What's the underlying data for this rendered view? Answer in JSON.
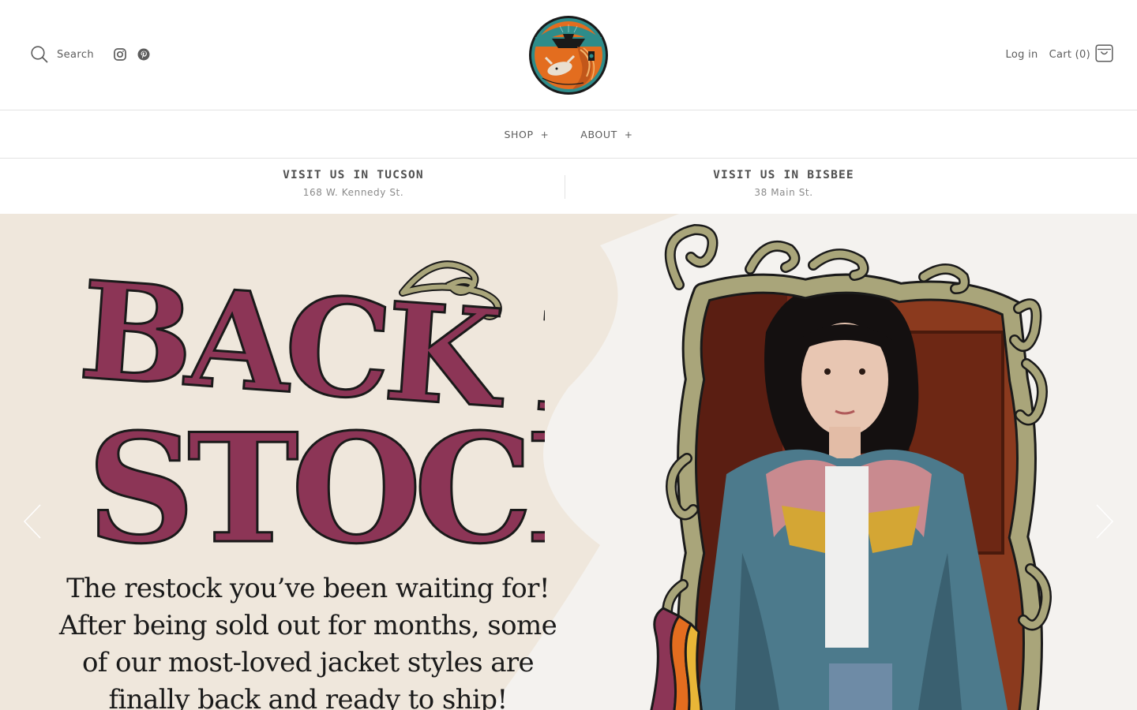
{
  "header": {
    "search_label": "Search",
    "login_label": "Log in",
    "cart_label": "Cart (0)",
    "social": [
      "instagram-icon",
      "pinterest-icon"
    ]
  },
  "nav": {
    "items": [
      {
        "label": "SHOP",
        "expand": "+"
      },
      {
        "label": "ABOUT",
        "expand": "+"
      }
    ]
  },
  "locations": [
    {
      "title": "VISIT US IN TUCSON",
      "address": "168 W. Kennedy St."
    },
    {
      "title": "VISIT US IN BISBEE",
      "address": "38 Main St."
    }
  ],
  "hero": {
    "headline_line1": "BACK IN",
    "headline_line2": "STOCK",
    "copy": [
      "The restock you’ve been waiting for!",
      "After being sold out for months, some",
      "of our most-loved jacket styles are",
      "finally back and ready to ship!"
    ],
    "colors": {
      "headline": "#8c3556",
      "background": "#efe7dc",
      "frame": "#a9a57a"
    }
  }
}
